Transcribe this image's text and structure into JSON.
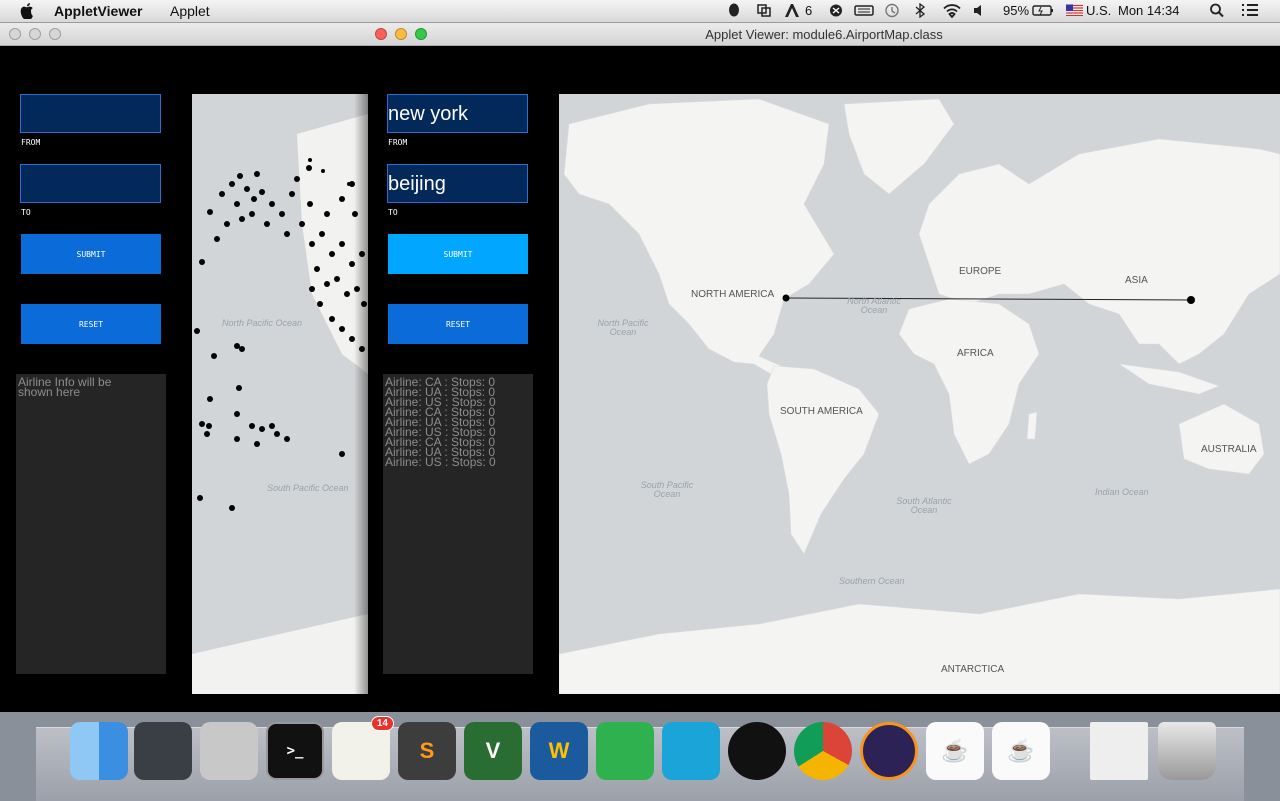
{
  "menubar": {
    "app_name": "AppletViewer",
    "menu_applet": "Applet",
    "notif_count": "6",
    "battery": "95%",
    "input_source": "U.S.",
    "clock": "Mon 14:34"
  },
  "window": {
    "title": "Applet Viewer: module6.AirportMap.class"
  },
  "left_panel": {
    "from_value": "",
    "from_caption": "FROM",
    "to_value": "",
    "to_caption": "TO",
    "submit_label": "SUBMIT",
    "reset_label": "RESET",
    "info_line1": "Airline Info will be",
    "info_line2": "shown here"
  },
  "right_panel": {
    "from_value": "new york",
    "from_caption": "FROM",
    "to_value": "beijing",
    "to_caption": "TO",
    "submit_label": "SUBMIT",
    "reset_label": "RESET",
    "results": [
      "Airline:  CA : Stops:  0",
      "Airline:  UA : Stops:  0",
      "Airline:  US : Stops:  0",
      "Airline:  CA : Stops:  0",
      "Airline:  UA : Stops:  0",
      "Airline:  US : Stops:  0",
      "Airline:  CA : Stops:  0",
      "Airline:  UA : Stops:  0",
      "Airline:  US : Stops:  0"
    ]
  },
  "left_map": {
    "ocean_north_pacific": "North Pacific Ocean",
    "ocean_south_pacific": "South Pacific Ocean"
  },
  "world_map": {
    "north_america": "NORTH AMERICA",
    "south_america": "SOUTH AMERICA",
    "europe": "EUROPE",
    "asia": "ASIA",
    "africa": "AFRICA",
    "australia": "AUSTRALIA",
    "antarctica": "ANTARCTICA",
    "north_atlantic": "North Atlantic Ocean",
    "north_pacific": "North Pacific Ocean",
    "south_pacific": "South Pacific Ocean",
    "south_atlantic": "South Atlantic Ocean",
    "indian": "Indian Ocean",
    "southern": "Southern Ocean"
  },
  "dock": {
    "reminders_badge": "14"
  },
  "colors": {
    "field_bg": "#03285a",
    "button": "#0b6cd9",
    "button_active": "#00a6ff",
    "map_land": "#f4f4f3",
    "map_water": "#d2d5d8"
  }
}
